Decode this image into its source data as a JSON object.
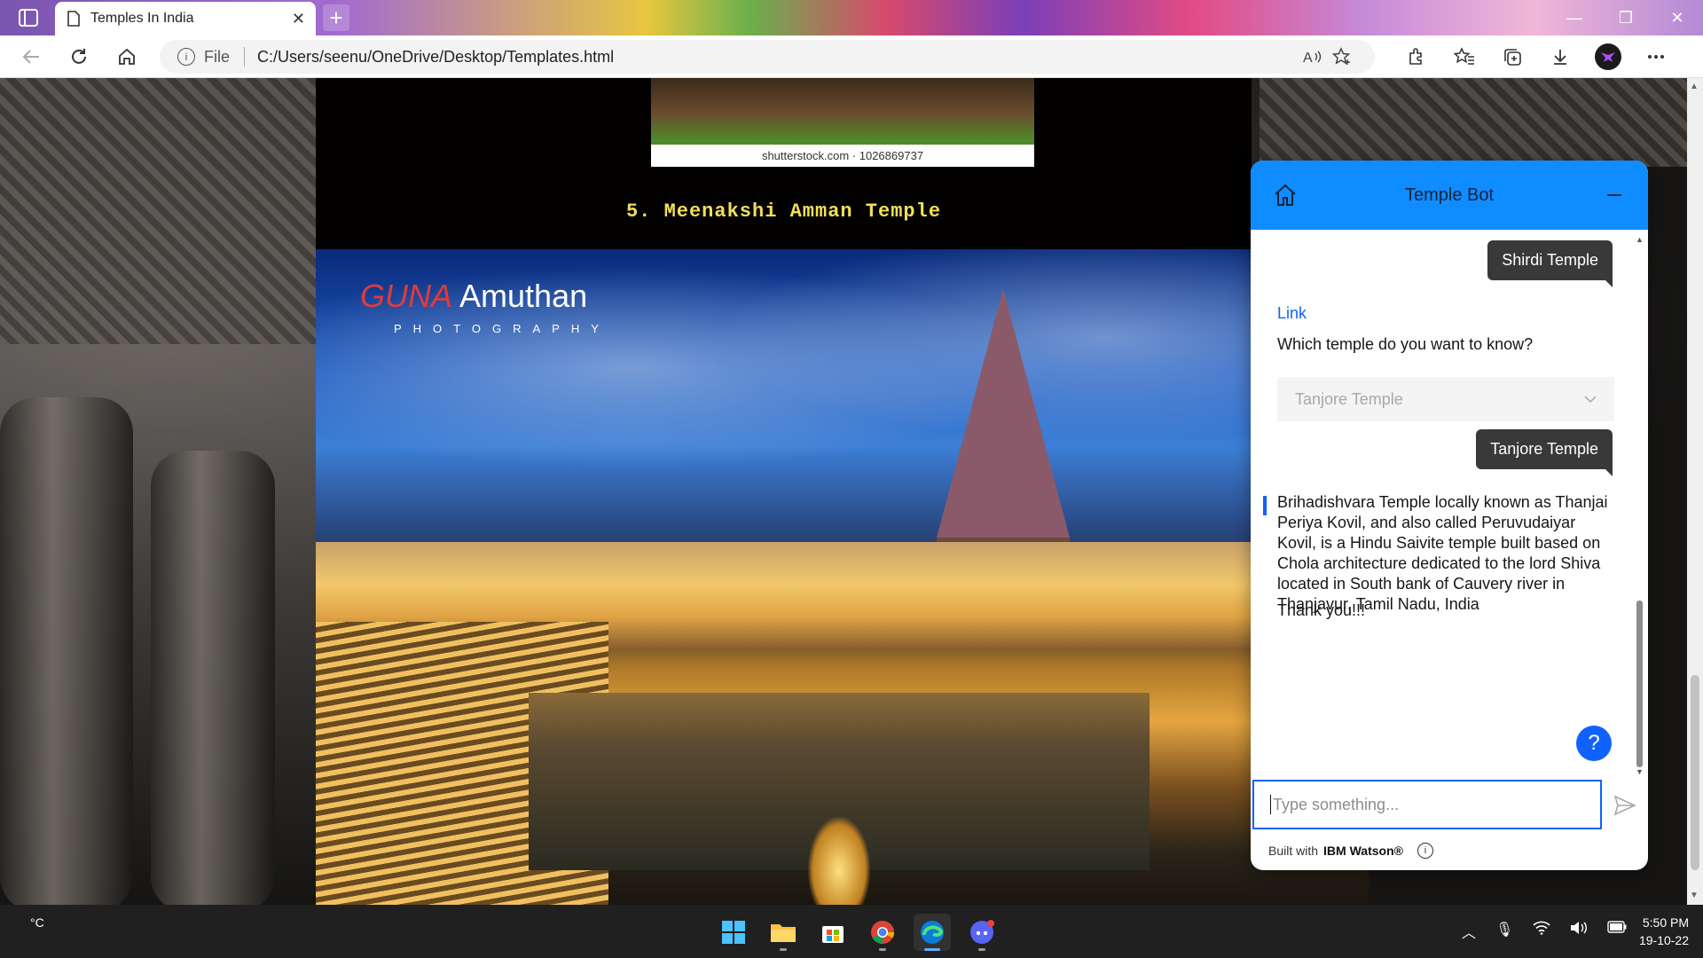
{
  "browser": {
    "tab_title": "Temples In India",
    "new_tab_symbol": "+",
    "url_scheme": "File",
    "url": "C:/Users/seenu/OneDrive/Desktop/Templates.html",
    "icons": [
      "tab-actions-icon",
      "page-icon",
      "close-icon",
      "back-icon",
      "refresh-icon",
      "home-icon",
      "info-icon",
      "read-aloud-icon",
      "favorite-add-icon",
      "extensions-icon",
      "favorites-icon",
      "collections-icon",
      "downloads-icon",
      "profile-icon",
      "more-icon",
      "minimize-icon",
      "restore-icon",
      "close-window-icon"
    ]
  },
  "page": {
    "top_image_caption": "shutterstock.com · 1026869737",
    "heading": "5. Meenakshi Amman Temple",
    "photo_logo_brand_a": "GUNA",
    "photo_logo_brand_b": "Amuthan",
    "photo_logo_sub": "PHOTOGRAPHY"
  },
  "chat": {
    "title": "Temple Bot",
    "user_message_1": "Shirdi Temple",
    "link_text": "Link",
    "question": "Which temple do you want to know?",
    "dropdown_value": "Tanjore Temple",
    "user_message_2": "Tanjore Temple",
    "answer": "Brihadishvara Temple locally known as Thanjai Periya Kovil, and also called Peruvudaiyar Kovil, is a Hindu Saivite temple built based on Chola architecture dedicated to the lord Shiva located in South bank of Cauvery river in Thanjavur, Tamil Nadu, India",
    "thanks": "Thank you!!!",
    "help_symbol": "?",
    "input_placeholder": "Type something...",
    "footer_prefix": "Built with",
    "footer_brand": "IBM Watson®",
    "accent_color": "#0f8cff",
    "button_color": "#0f62fe"
  },
  "taskbar": {
    "weather": "°C",
    "time": "5:50 PM",
    "date": "19-10-22",
    "apps": [
      "start-icon",
      "file-explorer-icon",
      "store-icon",
      "chrome-icon",
      "edge-icon",
      "discord-icon"
    ]
  }
}
